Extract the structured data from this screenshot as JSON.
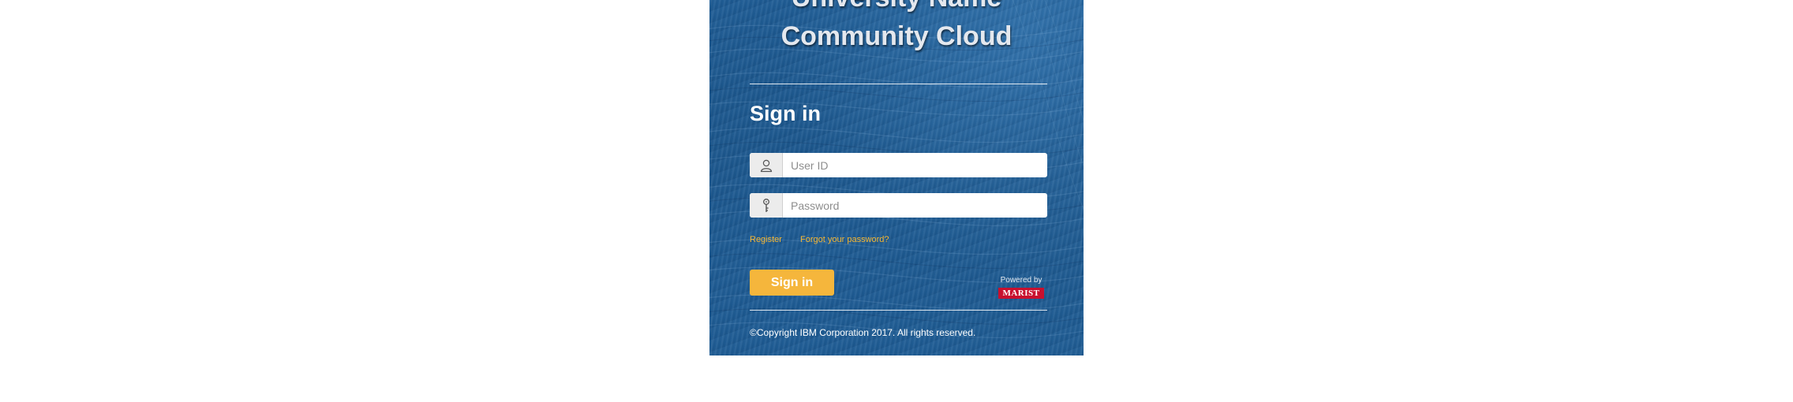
{
  "header": {
    "title_line_1": "University Name",
    "title_line_2": "Community Cloud"
  },
  "form": {
    "heading": "Sign in",
    "user_id": {
      "value": "",
      "placeholder": "User ID",
      "icon": "user-icon"
    },
    "password": {
      "value": "",
      "placeholder": "Password",
      "icon": "key-icon"
    },
    "register_link": "Register",
    "forgot_link": "Forgot your password?",
    "submit_label": "Sign in"
  },
  "powered_by": {
    "label": "Powered by",
    "logo_text": "MARIST"
  },
  "footer": {
    "copyright": "©Copyright IBM Corporation 2017. All rights reserved."
  },
  "colors": {
    "panel_blue": "#1e5b93",
    "accent_yellow": "#f5b63c",
    "link_yellow": "#f7b733",
    "marist_red": "#c8102e"
  }
}
